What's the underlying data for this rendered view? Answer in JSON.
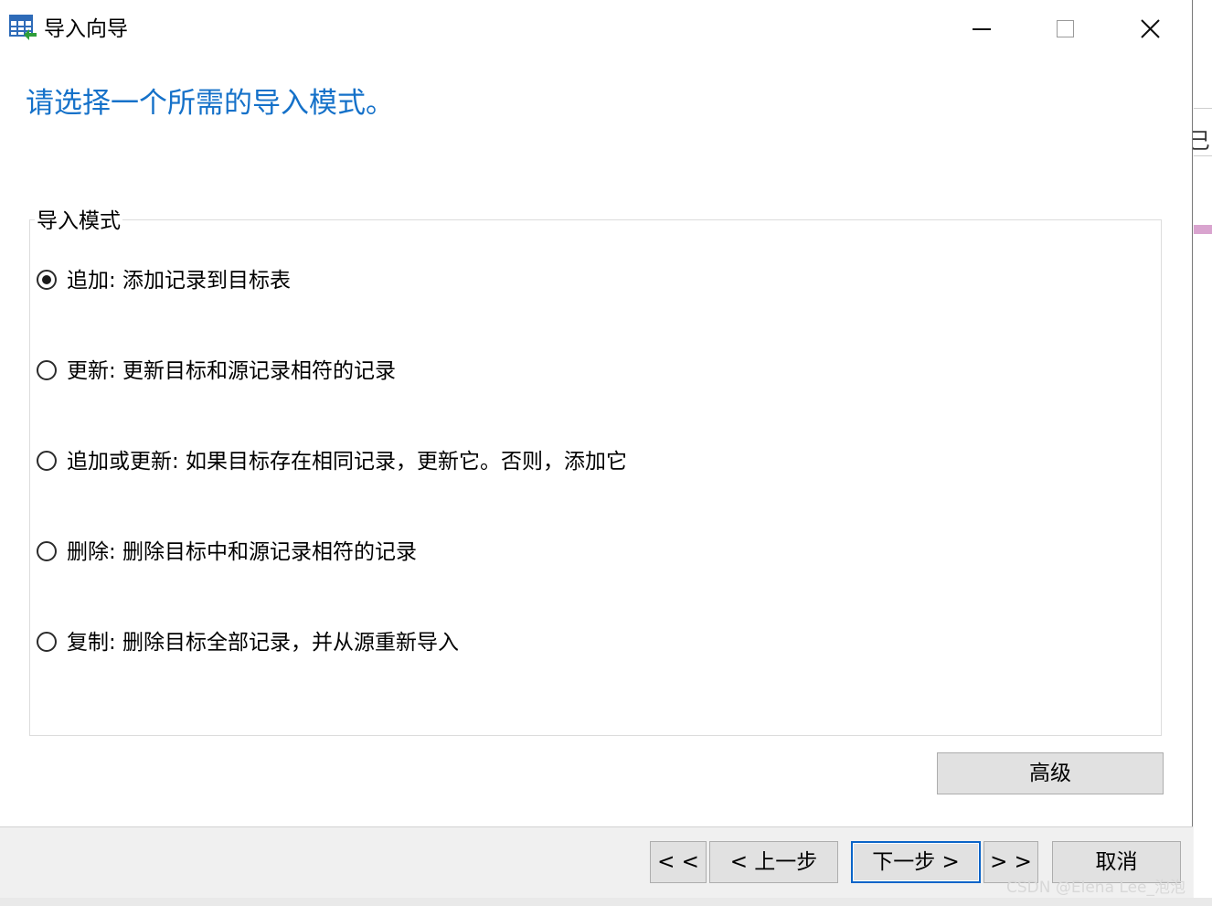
{
  "window": {
    "title": "导入向导",
    "icon": "table-import-icon",
    "controls": {
      "minimize": "minimize-icon",
      "maximize": "maximize-icon",
      "close": "close-icon",
      "close_glyph": "✕"
    }
  },
  "heading": "请选择一个所需的导入模式。",
  "import_mode": {
    "group_label": "导入模式",
    "selected_index": 0,
    "options": [
      {
        "label": "追加: 添加记录到目标表",
        "checked": true
      },
      {
        "label": "更新: 更新目标和源记录相符的记录",
        "checked": false
      },
      {
        "label": "追加或更新: 如果目标存在相同记录，更新它。否则，添加它",
        "checked": false
      },
      {
        "label": "删除: 删除目标中和源记录相符的记录",
        "checked": false
      },
      {
        "label": "复制: 删除目标全部记录，并从源重新导入",
        "checked": false
      }
    ]
  },
  "advanced_button": "高级",
  "nav": {
    "first": "< <",
    "back": "< 上一步",
    "next": "下一步 >",
    "last": "> >",
    "cancel": "取消"
  },
  "watermark": "CSDN @Elena Lee_泡泡",
  "colors": {
    "heading": "#1571c9",
    "default_button_border": "#0a64c8"
  }
}
